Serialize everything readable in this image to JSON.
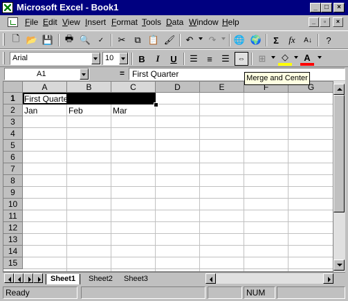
{
  "window": {
    "title": "Microsoft Excel - Book1"
  },
  "menu": [
    "File",
    "Edit",
    "View",
    "Insert",
    "Format",
    "Tools",
    "Data",
    "Window",
    "Help"
  ],
  "formatting": {
    "font_name": "Arial",
    "font_size": "10"
  },
  "formula_bar": {
    "name_box": "A1",
    "equals": "=",
    "content": "First Quarter"
  },
  "tooltip": "Merge and Center",
  "grid": {
    "columns": [
      "A",
      "B",
      "C",
      "D",
      "E",
      "F",
      "G"
    ],
    "rows": [
      "1",
      "2",
      "3",
      "4",
      "5",
      "6",
      "7",
      "8",
      "9",
      "10",
      "11",
      "12",
      "13",
      "14",
      "15"
    ],
    "cells": {
      "A1": "First Quarter",
      "A2": "Jan",
      "B2": "Feb",
      "C2": "Mar"
    }
  },
  "sheets": [
    "Sheet1",
    "Sheet2",
    "Sheet3"
  ],
  "status": {
    "left": "Ready",
    "num": "NUM"
  },
  "colors": {
    "title_bar": "#000080",
    "face": "#c0c0c0",
    "tooltip_bg": "#ffffe1"
  }
}
